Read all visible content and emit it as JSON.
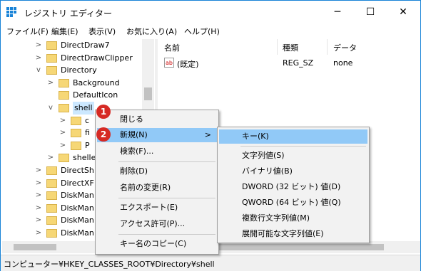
{
  "window": {
    "title": "レジストリ エディター",
    "minimize_glyph": "─",
    "maximize_glyph": "☐",
    "close_glyph": "✕"
  },
  "menubar": [
    "ファイル(F)",
    "編集(E)",
    "表示(V)",
    "お気に入り(A)",
    "ヘルプ(H)"
  ],
  "tree": [
    {
      "label": "DirectDraw7",
      "indent": 4,
      "twisty": ">"
    },
    {
      "label": "DirectDrawClipper",
      "indent": 4,
      "twisty": ">"
    },
    {
      "label": "Directory",
      "indent": 4,
      "twisty": "v"
    },
    {
      "label": "Background",
      "indent": 5,
      "twisty": ">"
    },
    {
      "label": "DefaultIcon",
      "indent": 5,
      "twisty": ""
    },
    {
      "label": "shell",
      "indent": 5,
      "twisty": "v",
      "selected": true
    },
    {
      "label": "c",
      "indent": 6,
      "twisty": ">"
    },
    {
      "label": "fi",
      "indent": 6,
      "twisty": ">"
    },
    {
      "label": "P",
      "indent": 6,
      "twisty": ">"
    },
    {
      "label": "shelle",
      "indent": 5,
      "twisty": ">"
    },
    {
      "label": "DirectSh",
      "indent": 4,
      "twisty": ">"
    },
    {
      "label": "DirectXF",
      "indent": 4,
      "twisty": ">"
    },
    {
      "label": "DiskMan",
      "indent": 4,
      "twisty": ">"
    },
    {
      "label": "DiskMan",
      "indent": 4,
      "twisty": ">"
    },
    {
      "label": "DiskMan",
      "indent": 4,
      "twisty": ">"
    },
    {
      "label": "DiskMan",
      "indent": 4,
      "twisty": ">"
    }
  ],
  "list": {
    "columns": [
      "名前",
      "種類",
      "データ"
    ],
    "rows": [
      {
        "icon": "ab",
        "name": "(既定)",
        "type": "REG_SZ",
        "data": "none"
      }
    ]
  },
  "context_menu": {
    "items": [
      "閉じる",
      "新規(N)",
      "検索(F)...",
      "削除(D)",
      "名前の変更(R)",
      "エクスポート(E)",
      "アクセス許可(P)...",
      "キー名のコピー(C)"
    ],
    "submenu_arrow": ">",
    "highlighted": "新規(N)"
  },
  "submenu": {
    "items": [
      "キー(K)",
      "文字列値(S)",
      "バイナリ値(B)",
      "DWORD (32 ビット) 値(D)",
      "QWORD (64 ビット) 値(Q)",
      "複数行文字列値(M)",
      "展開可能な文字列値(E)"
    ],
    "highlighted": "キー(K)"
  },
  "badges": [
    "1",
    "2"
  ],
  "statusbar": {
    "path": "コンピューター¥HKEY_CLASSES_ROOT¥Directory¥shell"
  },
  "colors": {
    "accent": "#1883d7",
    "highlight": "#91c9f7",
    "selected_tree": "#cce8ff",
    "badge": "#d62a24",
    "folder": "#f6d776"
  }
}
